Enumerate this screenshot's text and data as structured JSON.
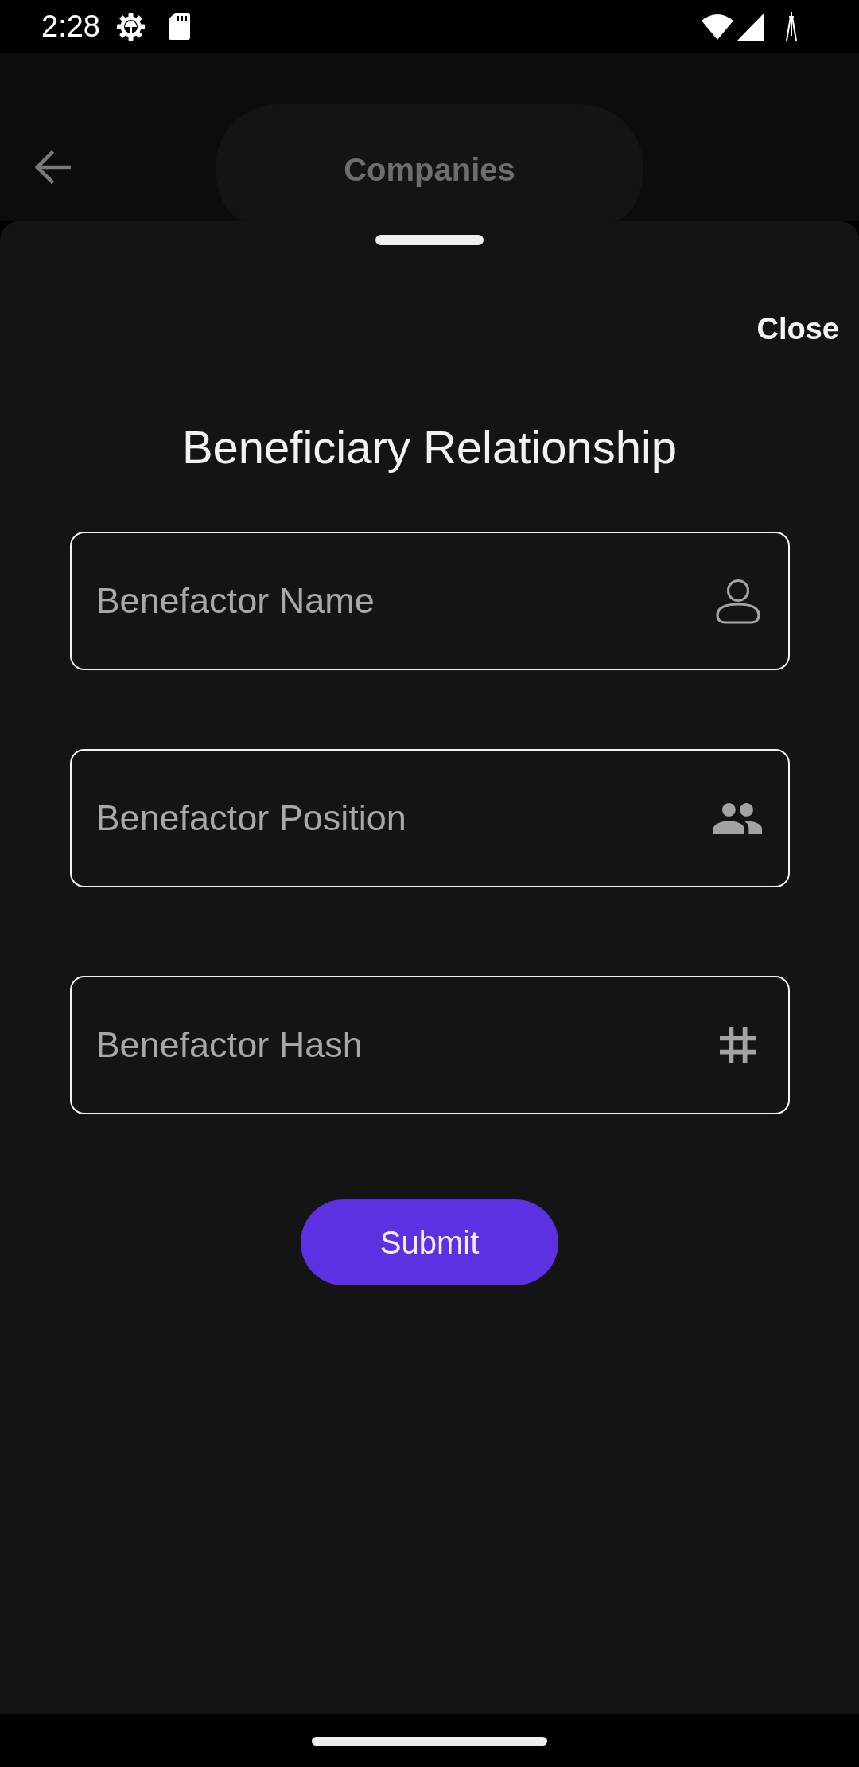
{
  "status_bar": {
    "time": "2:28"
  },
  "app_bar": {
    "title": "Companies"
  },
  "sheet": {
    "close": "Close",
    "title": "Beneficiary Relationship",
    "fields": [
      {
        "kind": "name",
        "placeholder": "Benefactor Name"
      },
      {
        "kind": "position",
        "placeholder": "Benefactor Position"
      },
      {
        "kind": "hash",
        "placeholder": "Benefactor Hash"
      }
    ],
    "submit": "Submit"
  }
}
